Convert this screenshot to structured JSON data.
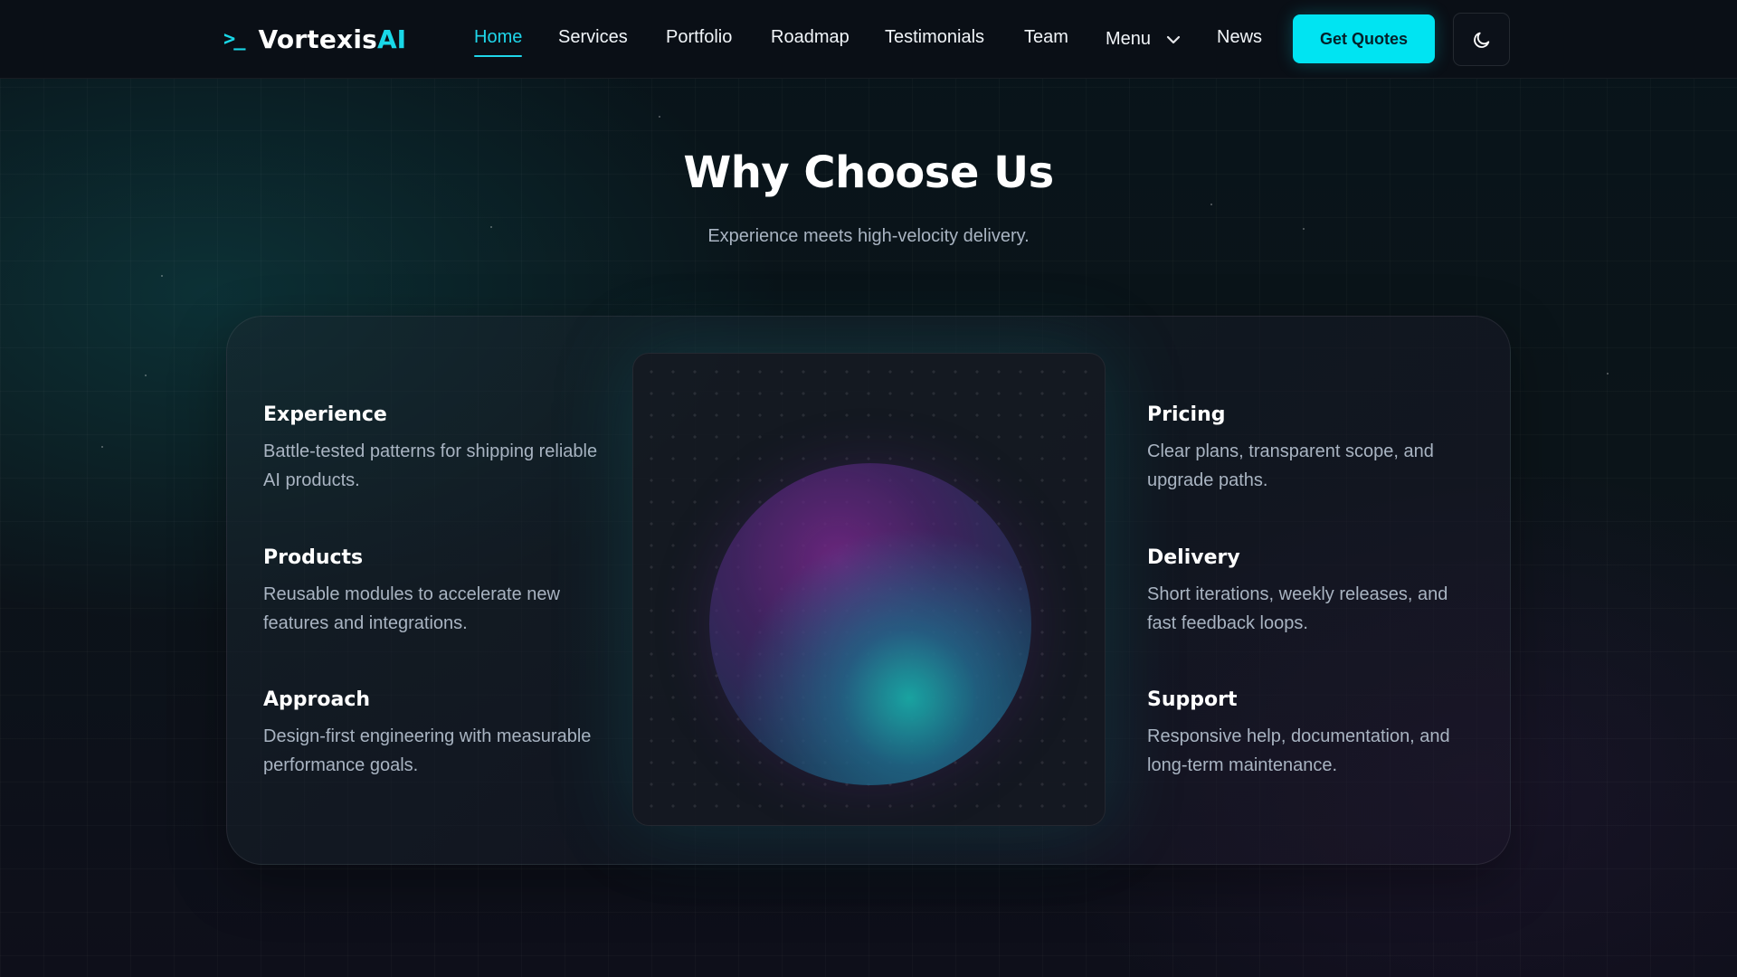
{
  "nav": {
    "brand_prefix": "Vortexis",
    "brand_accent": "AI",
    "brand_icon": "terminal-prompt-icon",
    "items": [
      {
        "label": "Home",
        "active": true
      },
      {
        "label": "Services"
      },
      {
        "label": "Portfolio"
      },
      {
        "label": "Roadmap"
      },
      {
        "label": "Testimonials"
      },
      {
        "label": "Team"
      },
      {
        "label": "Menu",
        "has_dropdown": true
      },
      {
        "label": "News"
      }
    ],
    "cta_label": "Get Quotes",
    "theme_toggle_icon": "moon-icon"
  },
  "section": {
    "title": "Why Choose Us",
    "subtitle": "Experience meets high-velocity delivery."
  },
  "features": {
    "left": [
      {
        "title": "Experience",
        "desc": "Battle-tested patterns for shipping reliable AI products."
      },
      {
        "title": "Products",
        "desc": "Reusable modules to accelerate new features and integrations."
      },
      {
        "title": "Approach",
        "desc": "Design-first engineering with measurable performance goals."
      }
    ],
    "right": [
      {
        "title": "Pricing",
        "desc": "Clear plans, transparent scope, and upgrade paths."
      },
      {
        "title": "Delivery",
        "desc": "Short iterations, weekly releases, and fast feedback loops."
      },
      {
        "title": "Support",
        "desc": "Responsive help, documentation, and long-term maintenance."
      }
    ]
  },
  "colors": {
    "accent": "#00e4f2",
    "background": "#0b1419",
    "muted_text": "#a9b4c2"
  }
}
